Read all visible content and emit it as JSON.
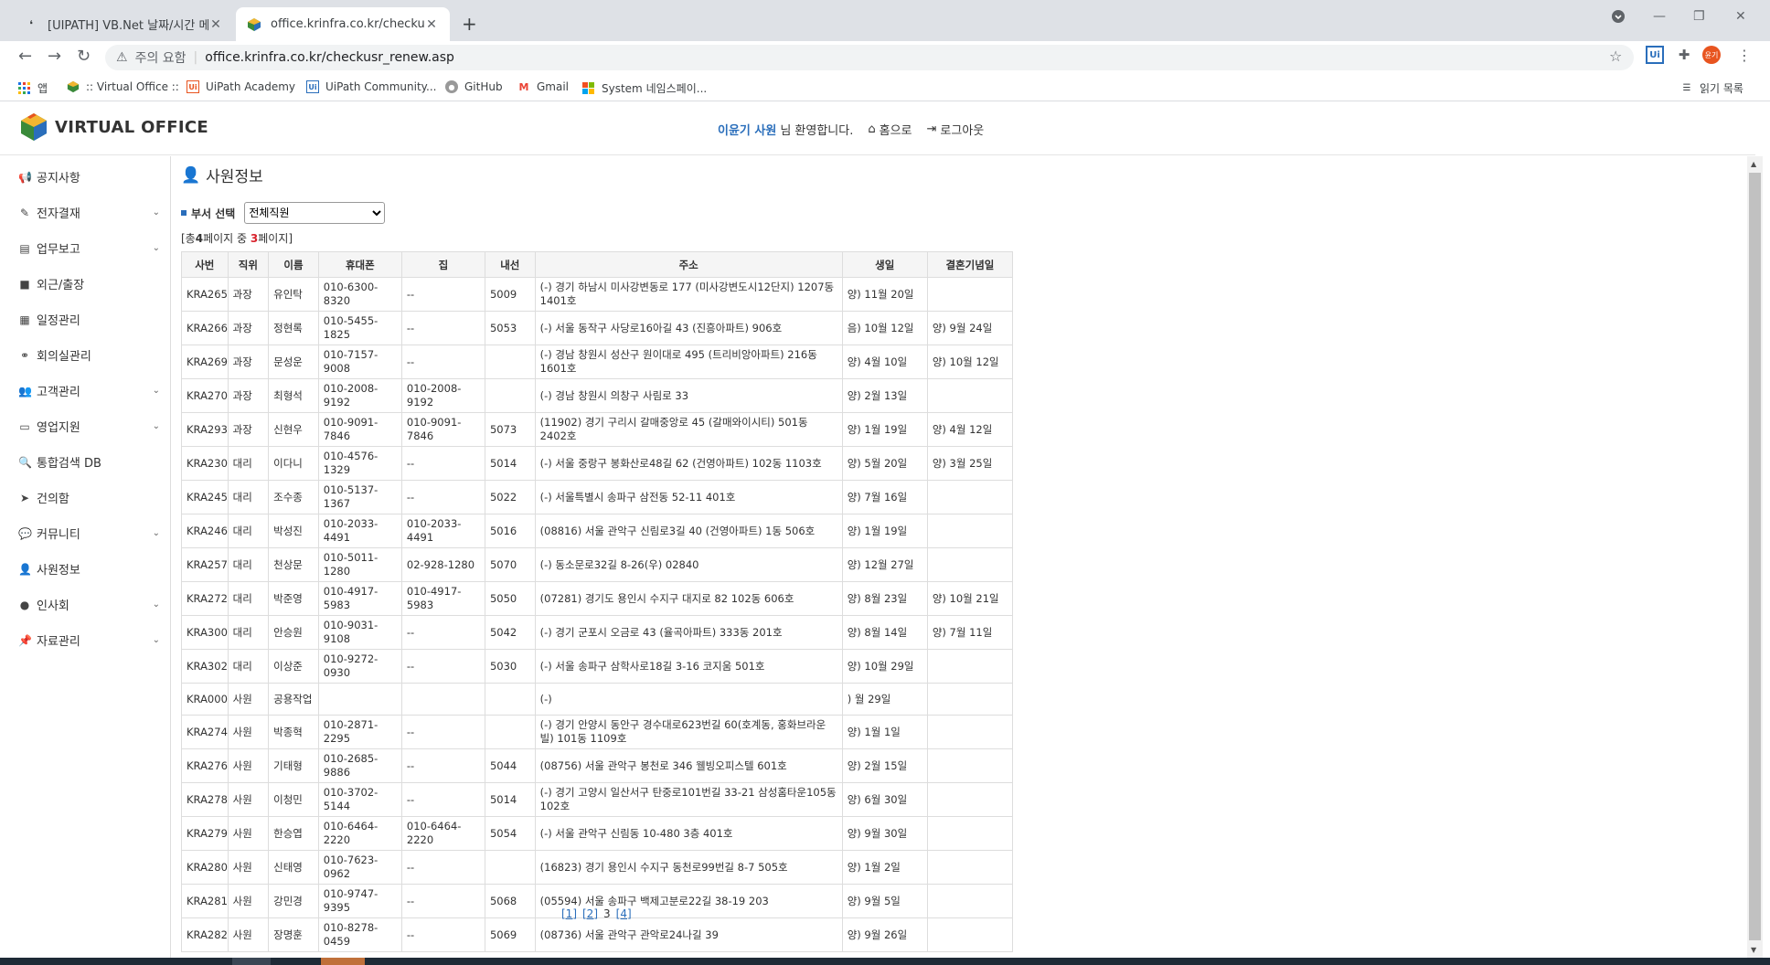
{
  "browser": {
    "tabs": [
      {
        "title": "[UIPATH] VB.Net 날짜/시간 메소",
        "active": false,
        "close": "✕"
      },
      {
        "title": "office.krinfra.co.kr/checkusr_rene",
        "active": true,
        "close": "✕"
      }
    ],
    "new_tab": "+",
    "address": {
      "security_label": "주의 요함",
      "url": "office.krinfra.co.kr/checkusr_renew.asp"
    },
    "profile_badge": "윤기",
    "bookmarks": [
      {
        "label": "앱",
        "icon": "apps-grid-icon"
      },
      {
        "label": ":: Virtual Office ::",
        "icon": "virtual-office-icon"
      },
      {
        "label": "UiPath Academy",
        "icon": "uipath-icon"
      },
      {
        "label": "UiPath Community...",
        "icon": "uipath-icon"
      },
      {
        "label": "GitHub",
        "icon": "github-icon"
      },
      {
        "label": "Gmail",
        "icon": "gmail-icon"
      },
      {
        "label": "System 네임스페이...",
        "icon": "microsoft-icon"
      }
    ],
    "reading_list": "읽기 목록"
  },
  "app": {
    "logo_text": "VIRTUAL OFFICE",
    "user_name": "이윤기 사원",
    "welcome_suffix": "님 환영합니다.",
    "home_label": "홈으로",
    "logout_label": "로그아웃"
  },
  "sidebar": {
    "items": [
      {
        "label": "공지사항",
        "icon": "megaphone-icon",
        "has_sub": false
      },
      {
        "label": "전자결재",
        "icon": "edit-icon",
        "has_sub": true
      },
      {
        "label": "업무보고",
        "icon": "document-icon",
        "has_sub": true
      },
      {
        "label": "외근/출장",
        "icon": "briefcase-icon",
        "has_sub": false
      },
      {
        "label": "일정관리",
        "icon": "calendar-icon",
        "has_sub": false
      },
      {
        "label": "회의실관리",
        "icon": "group-icon",
        "has_sub": false
      },
      {
        "label": "고객관리",
        "icon": "users-icon",
        "has_sub": true
      },
      {
        "label": "영업지원",
        "icon": "folder-open-icon",
        "has_sub": true
      },
      {
        "label": "통합검색 DB",
        "icon": "search-icon",
        "has_sub": false
      },
      {
        "label": "건의함",
        "icon": "send-icon",
        "has_sub": false
      },
      {
        "label": "커뮤니티",
        "icon": "chat-icon",
        "has_sub": true
      },
      {
        "label": "사원정보",
        "icon": "user-icon",
        "has_sub": false
      },
      {
        "label": "인사회",
        "icon": "circle-icon",
        "has_sub": true
      },
      {
        "label": "자료관리",
        "icon": "pin-icon",
        "has_sub": true
      }
    ]
  },
  "main": {
    "title": "사원정보",
    "dept_label": "부서 선택",
    "dept_selected": "전체직원",
    "page_info": {
      "prefix": "[총",
      "total": "4",
      "middle": "페이지 중 ",
      "current": "3",
      "suffix": "페이지]"
    },
    "columns": [
      "사번",
      "직위",
      "이름",
      "휴대폰",
      "집",
      "내선",
      "주소",
      "생일",
      "결혼기념일"
    ],
    "rows": [
      [
        "KRA265",
        "과장",
        "유인탁",
        "010-6300-8320",
        "--",
        "5009",
        "(-) 경기 하남시 미사강변동로 177 (미사강변도시12단지) 1207동 1401호",
        "양) 11월 20일",
        ""
      ],
      [
        "KRA266",
        "과장",
        "정현록",
        "010-5455-1825",
        "--",
        "5053",
        "(-) 서울 동작구 사당로16아길 43 (진흥아파트) 906호",
        "음) 10월 12일",
        "양) 9월 24일"
      ],
      [
        "KRA269",
        "과장",
        "문성운",
        "010-7157-9008",
        "--",
        "",
        "(-) 경남 창원시 성산구 원이대로 495 (트리비앙아파트) 216동 1601호",
        "양) 4월 10일",
        "양) 10월 12일"
      ],
      [
        "KRA270",
        "과장",
        "최형석",
        "010-2008-9192",
        "010-2008-9192",
        "",
        "(-) 경남 창원시 의창구 사림로 33",
        "양) 2월 13일",
        ""
      ],
      [
        "KRA293",
        "과장",
        "신현우",
        "010-9091-7846",
        "010-9091-7846",
        "5073",
        "(11902) 경기 구리시 갈매중앙로 45 (갈매와이시티) 501동 2402호",
        "양) 1월 19일",
        "양) 4월 12일"
      ],
      [
        "KRA230",
        "대리",
        "이다니",
        "010-4576-1329",
        "--",
        "5014",
        "(-) 서울 중랑구 봉화산로48길 62 (건영아파트) 102동 1103호",
        "양) 5월 20일",
        "양) 3월 25일"
      ],
      [
        "KRA245",
        "대리",
        "조수종",
        "010-5137-1367",
        "--",
        "5022",
        "(-) 서울특별시 송파구 삼전동 52-11 401호",
        "양) 7월 16일",
        ""
      ],
      [
        "KRA246",
        "대리",
        "박성진",
        "010-2033-4491",
        "010-2033-4491",
        "5016",
        "(08816) 서울 관악구 신림로3길 40 (건영아파트) 1동 506호",
        "양) 1월 19일",
        ""
      ],
      [
        "KRA257",
        "대리",
        "천상문",
        "010-5011-1280",
        "02-928-1280",
        "5070",
        "(-) 동소문로32길 8-26(우) 02840",
        "양) 12월 27일",
        ""
      ],
      [
        "KRA272",
        "대리",
        "박준영",
        "010-4917-5983",
        "010-4917-5983",
        "5050",
        "(07281) 경기도 용인시 수지구 대지로 82 102동 606호",
        "양) 8월 23일",
        "양) 10월 21일"
      ],
      [
        "KRA300",
        "대리",
        "안승원",
        "010-9031-9108",
        "--",
        "5042",
        "(-) 경기 군포시 오금로 43 (율곡아파트) 333동 201호",
        "양) 8월 14일",
        "양) 7월 11일"
      ],
      [
        "KRA302",
        "대리",
        "이상준",
        "010-9272-0930",
        "--",
        "5030",
        "(-) 서울 송파구 삼학사로18길 3-16 코지움 501호",
        "양) 10월 29일",
        ""
      ],
      [
        "KRA000",
        "사원",
        "공용작업",
        "",
        "",
        "",
        "(-)",
        ") 월 29일",
        ""
      ],
      [
        "KRA274",
        "사원",
        "박종혁",
        "010-2871-2295",
        "--",
        "",
        "(-) 경기 안양시 동안구 경수대로623번길 60(호계동, 홍화브라운빌) 101동 1109호",
        "양) 1월 1일",
        ""
      ],
      [
        "KRA276",
        "사원",
        "기태형",
        "010-2685-9886",
        "--",
        "5044",
        "(08756) 서울 관악구 봉천로 346 웰빙오피스텔 601호",
        "양) 2월 15일",
        ""
      ],
      [
        "KRA278",
        "사원",
        "이청민",
        "010-3702-5144",
        "--",
        "5014",
        "(-) 경기 고양시 일산서구 탄중로101번길 33-21 삼성홈타운105동102호",
        "양) 6월 30일",
        ""
      ],
      [
        "KRA279",
        "사원",
        "한승엽",
        "010-6464-2220",
        "010-6464-2220",
        "5054",
        "(-) 서울 관악구 신림동 10-480 3층 401호",
        "양) 9월 30일",
        ""
      ],
      [
        "KRA280",
        "사원",
        "신태영",
        "010-7623-0962",
        "--",
        "",
        "(16823) 경기 용인시 수지구 동천로99번길 8-7 505호",
        "양) 1월 2일",
        ""
      ],
      [
        "KRA281",
        "사원",
        "강민경",
        "010-9747-9395",
        "--",
        "5068",
        "(05594) 서울 송파구 백제고분로22길 38-19 203",
        "양) 9월 5일",
        ""
      ],
      [
        "KRA282",
        "사원",
        "장명훈",
        "010-8278-0459",
        "--",
        "5069",
        "(08736) 서울 관악구 관악로24나길 39",
        "양) 9월 26일",
        ""
      ]
    ],
    "pager": [
      "[1]",
      "[2]",
      "3",
      "[4]"
    ]
  },
  "colors": {
    "accent": "#2a6ebb",
    "highlight": "#d9232d",
    "tab_bar": "#dee1e6"
  }
}
